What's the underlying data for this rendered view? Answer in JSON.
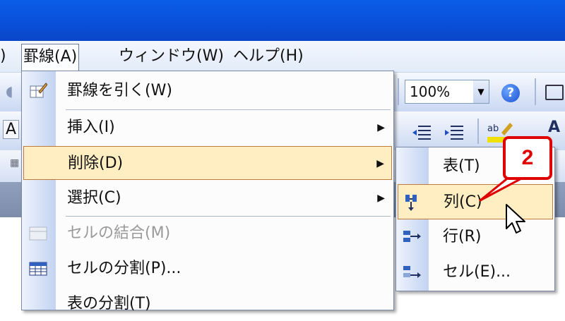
{
  "menubar": {
    "left_fragment": ")",
    "items": [
      {
        "label": "罫線(A)"
      },
      {
        "label": "ウィンドウ(W)"
      },
      {
        "label": "ヘルプ(H)"
      }
    ]
  },
  "toolbar": {
    "zoom_value": "100%",
    "help_label": "?",
    "left_fragment_a": "A"
  },
  "menu": {
    "items": [
      {
        "label": "罫線を引く(W)",
        "icon": "pencil-icon",
        "has_submenu": false,
        "disabled": false
      },
      {
        "label": "挿入(I)",
        "icon": "",
        "has_submenu": true,
        "disabled": false
      },
      {
        "label": "削除(D)",
        "icon": "",
        "has_submenu": true,
        "disabled": false,
        "highlighted": true
      },
      {
        "label": "選択(C)",
        "icon": "",
        "has_submenu": true,
        "disabled": false
      },
      {
        "label": "セルの結合(M)",
        "icon": "merge-cells-icon",
        "has_submenu": false,
        "disabled": true
      },
      {
        "label": "セルの分割(P)...",
        "icon": "split-cells-icon",
        "has_submenu": false,
        "disabled": false
      },
      {
        "label": "表の分割(T)",
        "icon": "",
        "has_submenu": false,
        "disabled": false
      }
    ]
  },
  "submenu": {
    "items": [
      {
        "label": "表(T)",
        "icon": ""
      },
      {
        "label": "列(C)",
        "icon": "delete-column-icon",
        "highlighted": true
      },
      {
        "label": "行(R)",
        "icon": "delete-row-icon"
      },
      {
        "label": "セル(E)...",
        "icon": "delete-cell-icon"
      }
    ]
  },
  "callout": {
    "number": "2"
  },
  "colors": {
    "title_blue": "#0a5de8",
    "highlight_fill": "#ffeec2",
    "highlight_border": "#c07a3a",
    "callout_red": "#e00000"
  }
}
